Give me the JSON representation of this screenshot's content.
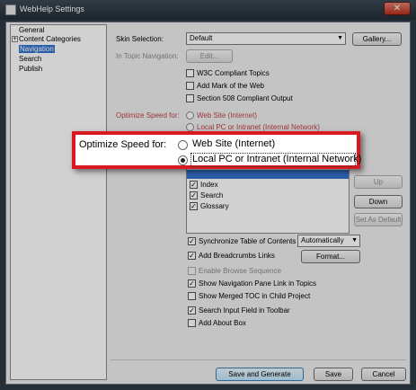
{
  "window": {
    "title": "WebHelp Settings",
    "close_glyph": "✕"
  },
  "tree": {
    "items": [
      {
        "label": "General"
      },
      {
        "label": "Content Categories",
        "expander": "+"
      },
      {
        "label": "Navigation",
        "selected": true
      },
      {
        "label": "Search"
      },
      {
        "label": "Publish"
      }
    ]
  },
  "skin": {
    "label": "Skin Selection:",
    "value": "Default",
    "gallery_button": "Gallery..."
  },
  "in_topic": {
    "label": "In Topic Navigation:",
    "edit_button": "Edit..."
  },
  "topic_checks": [
    {
      "label": "W3C Compliant Topics",
      "checked": false
    },
    {
      "label": "Add Mark of the Web",
      "checked": false
    },
    {
      "label": "Section 508 Compliant Output",
      "checked": false
    }
  ],
  "optimize_bg": {
    "label": "Optimize Speed for:",
    "opt1": "Web Site (Internet)",
    "opt2": "Local PC or Intranet (Internal Network)"
  },
  "zoom": {
    "label": "Optimize Speed for:",
    "options": [
      {
        "label": "Web Site (Internet)",
        "selected": false
      },
      {
        "label": "Local PC or Intranet (Internal Network)",
        "selected": true
      }
    ]
  },
  "nav_list": {
    "items": [
      {
        "label": "Index",
        "checked": true
      },
      {
        "label": "Search",
        "checked": true
      },
      {
        "label": "Glossary",
        "checked": true
      }
    ]
  },
  "list_buttons": {
    "up": "Up",
    "down": "Down",
    "set_default": "Set As Default"
  },
  "bottom_checks": [
    {
      "label": "Synchronize Table of Contents",
      "checked": true
    },
    {
      "label": "Add Breadcrumbs Links",
      "checked": true
    },
    {
      "label": "Enable Browse Sequence",
      "checked": false,
      "disabled": true
    },
    {
      "label": "Show Navigation Pane Link in Topics",
      "checked": true
    },
    {
      "label": "Show Merged TOC in Child Project",
      "checked": false
    },
    {
      "label": "Search Input Field in Toolbar",
      "checked": true
    },
    {
      "label": "Add About Box",
      "checked": false
    }
  ],
  "sync_dropdown": "Automatically",
  "format_button": "Format...",
  "footer": {
    "save_generate": "Save and Generate",
    "save": "Save",
    "cancel": "Cancel"
  },
  "check_glyph": "✓"
}
